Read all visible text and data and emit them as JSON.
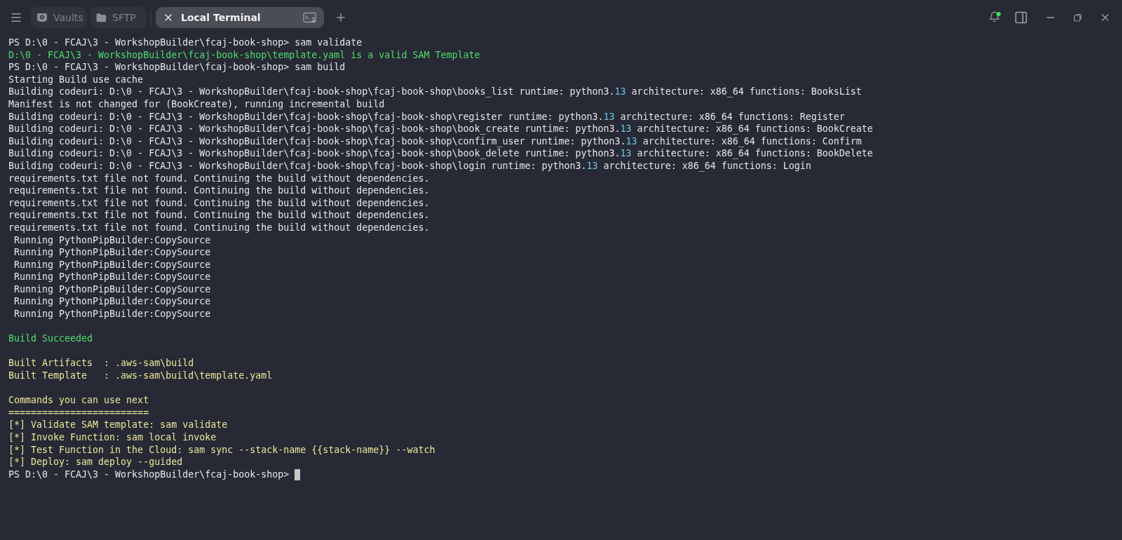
{
  "tabs": [
    {
      "label": "Vaults",
      "kind": "vaults",
      "selected": false
    },
    {
      "label": "SFTP",
      "kind": "sftp",
      "selected": false
    },
    {
      "label": "Local Terminal",
      "kind": "terminal",
      "selected": true
    }
  ],
  "notifications": {
    "unread": true
  },
  "terminal": {
    "cursor_visible": true,
    "lines": [
      {
        "kind": "text",
        "spans": [
          {
            "text": "PS D:\\0 - FCAJ\\3 - WorkshopBuilder\\fcaj-book-shop> sam validate",
            "kind": "plain"
          }
        ]
      },
      {
        "kind": "text",
        "spans": [
          {
            "text": "D:\\0 - FCAJ\\3 - WorkshopBuilder\\fcaj-book-shop\\template.yaml is a valid SAM Template",
            "kind": "success"
          }
        ]
      },
      {
        "kind": "text",
        "spans": [
          {
            "text": "PS D:\\0 - FCAJ\\3 - WorkshopBuilder\\fcaj-book-shop> sam build",
            "kind": "plain"
          }
        ]
      },
      {
        "kind": "text",
        "spans": [
          {
            "text": "Starting Build use cache",
            "kind": "plain"
          }
        ]
      },
      {
        "kind": "text",
        "spans": [
          {
            "text": "Building codeuri: D:\\0 - FCAJ\\3 - WorkshopBuilder\\fcaj-book-shop\\fcaj-book-shop\\books_list runtime: python3.",
            "kind": "plain"
          },
          {
            "text": "13",
            "kind": "number"
          },
          {
            "text": " architecture: x86_64 functions: BooksList",
            "kind": "plain"
          }
        ]
      },
      {
        "kind": "text",
        "spans": [
          {
            "text": "Manifest is not changed for (BookCreate), running incremental build",
            "kind": "plain"
          }
        ]
      },
      {
        "kind": "text",
        "spans": [
          {
            "text": "Building codeuri: D:\\0 - FCAJ\\3 - WorkshopBuilder\\fcaj-book-shop\\fcaj-book-shop\\register runtime: python3.",
            "kind": "plain"
          },
          {
            "text": "13",
            "kind": "number"
          },
          {
            "text": " architecture: x86_64 functions: Register",
            "kind": "plain"
          }
        ]
      },
      {
        "kind": "text",
        "spans": [
          {
            "text": "Building codeuri: D:\\0 - FCAJ\\3 - WorkshopBuilder\\fcaj-book-shop\\fcaj-book-shop\\book_create runtime: python3.",
            "kind": "plain"
          },
          {
            "text": "13",
            "kind": "number"
          },
          {
            "text": " architecture: x86_64 functions: BookCreate",
            "kind": "plain"
          }
        ]
      },
      {
        "kind": "text",
        "spans": [
          {
            "text": "Building codeuri: D:\\0 - FCAJ\\3 - WorkshopBuilder\\fcaj-book-shop\\fcaj-book-shop\\confirm_user runtime: python3.",
            "kind": "plain"
          },
          {
            "text": "13",
            "kind": "number"
          },
          {
            "text": " architecture: x86_64 functions: Confirm",
            "kind": "plain"
          }
        ]
      },
      {
        "kind": "text",
        "spans": [
          {
            "text": "Building codeuri: D:\\0 - FCAJ\\3 - WorkshopBuilder\\fcaj-book-shop\\fcaj-book-shop\\book_delete runtime: python3.",
            "kind": "plain"
          },
          {
            "text": "13",
            "kind": "number"
          },
          {
            "text": " architecture: x86_64 functions: BookDelete",
            "kind": "plain"
          }
        ]
      },
      {
        "kind": "text",
        "spans": [
          {
            "text": "Building codeuri: D:\\0 - FCAJ\\3 - WorkshopBuilder\\fcaj-book-shop\\fcaj-book-shop\\login runtime: python3.",
            "kind": "plain"
          },
          {
            "text": "13",
            "kind": "number"
          },
          {
            "text": " architecture: x86_64 functions: Login",
            "kind": "plain"
          }
        ]
      },
      {
        "kind": "text",
        "spans": [
          {
            "text": "requirements.txt file not found. Continuing the build without dependencies.",
            "kind": "plain"
          }
        ]
      },
      {
        "kind": "text",
        "spans": [
          {
            "text": "requirements.txt file not found. Continuing the build without dependencies.",
            "kind": "plain"
          }
        ]
      },
      {
        "kind": "text",
        "spans": [
          {
            "text": "requirements.txt file not found. Continuing the build without dependencies.",
            "kind": "plain"
          }
        ]
      },
      {
        "kind": "text",
        "spans": [
          {
            "text": "requirements.txt file not found. Continuing the build without dependencies.",
            "kind": "plain"
          }
        ]
      },
      {
        "kind": "text",
        "spans": [
          {
            "text": "requirements.txt file not found. Continuing the build without dependencies.",
            "kind": "plain"
          }
        ]
      },
      {
        "kind": "text",
        "spans": [
          {
            "text": " Running PythonPipBuilder:CopySource",
            "kind": "plain"
          }
        ]
      },
      {
        "kind": "text",
        "spans": [
          {
            "text": " Running PythonPipBuilder:CopySource",
            "kind": "plain"
          }
        ]
      },
      {
        "kind": "text",
        "spans": [
          {
            "text": " Running PythonPipBuilder:CopySource",
            "kind": "plain"
          }
        ]
      },
      {
        "kind": "text",
        "spans": [
          {
            "text": " Running PythonPipBuilder:CopySource",
            "kind": "plain"
          }
        ]
      },
      {
        "kind": "text",
        "spans": [
          {
            "text": " Running PythonPipBuilder:CopySource",
            "kind": "plain"
          }
        ]
      },
      {
        "kind": "text",
        "spans": [
          {
            "text": " Running PythonPipBuilder:CopySource",
            "kind": "plain"
          }
        ]
      },
      {
        "kind": "text",
        "spans": [
          {
            "text": " Running PythonPipBuilder:CopySource",
            "kind": "plain"
          }
        ]
      },
      {
        "kind": "blank"
      },
      {
        "kind": "text",
        "spans": [
          {
            "text": "Build Succeeded",
            "kind": "success"
          }
        ]
      },
      {
        "kind": "blank"
      },
      {
        "kind": "text",
        "spans": [
          {
            "text": "Built Artifacts  : .aws-sam\\build",
            "kind": "notice"
          }
        ]
      },
      {
        "kind": "text",
        "spans": [
          {
            "text": "Built Template   : .aws-sam\\build\\template.yaml",
            "kind": "notice"
          }
        ]
      },
      {
        "kind": "blank"
      },
      {
        "kind": "text",
        "spans": [
          {
            "text": "Commands you can use next",
            "kind": "notice"
          }
        ]
      },
      {
        "kind": "text",
        "spans": [
          {
            "text": "=========================",
            "kind": "notice"
          }
        ]
      },
      {
        "kind": "text",
        "spans": [
          {
            "text": "[*] Validate SAM template: sam validate",
            "kind": "notice"
          }
        ]
      },
      {
        "kind": "text",
        "spans": [
          {
            "text": "[*] Invoke Function: sam local invoke",
            "kind": "notice"
          }
        ]
      },
      {
        "kind": "text",
        "spans": [
          {
            "text": "[*] Test Function in the Cloud: sam sync --stack-name {{stack-name}} --watch",
            "kind": "notice"
          }
        ]
      },
      {
        "kind": "text",
        "spans": [
          {
            "text": "[*] Deploy: sam deploy --guided",
            "kind": "notice"
          }
        ]
      },
      {
        "kind": "text",
        "spans": [
          {
            "text": "PS D:\\0 - FCAJ\\3 - WorkshopBuilder\\fcaj-book-shop> ",
            "kind": "plain"
          }
        ]
      }
    ]
  }
}
